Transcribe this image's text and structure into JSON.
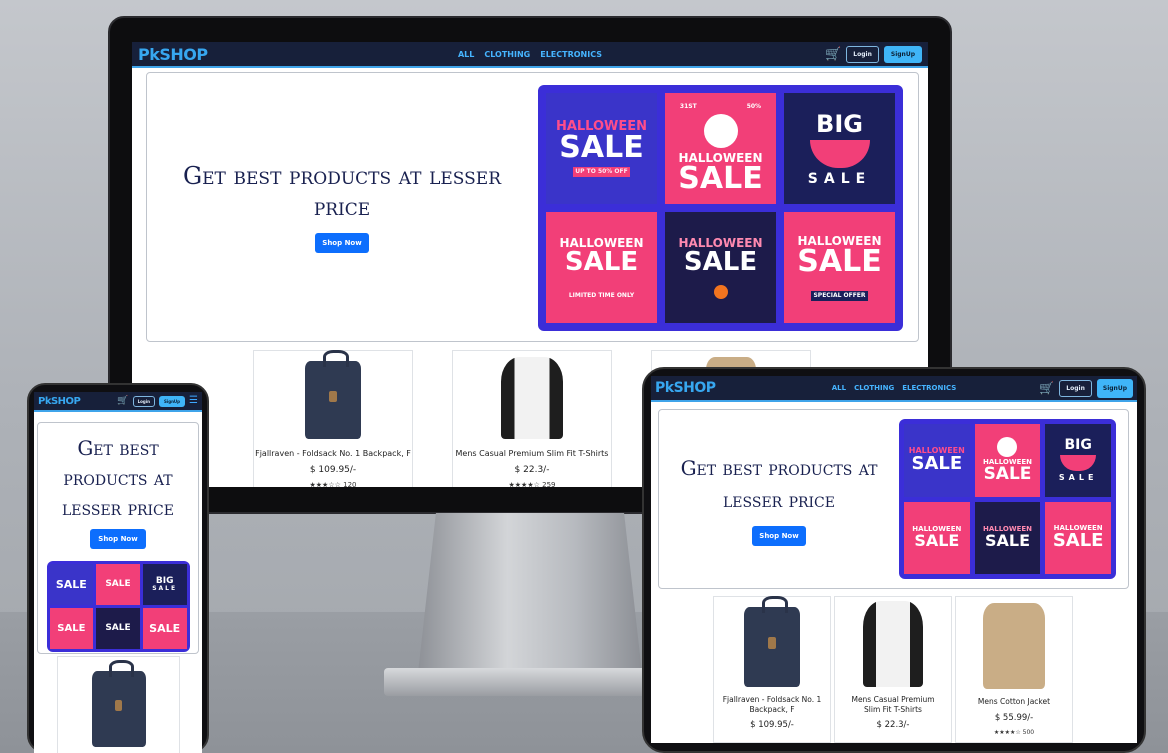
{
  "brand": "PkSHOP",
  "nav": {
    "links": [
      "ALL",
      "CLOTHING",
      "ELECTRONICS"
    ],
    "login": "Login",
    "signup": "SignUp"
  },
  "hero": {
    "tagline": "Get best products at lesser price",
    "cta": "Shop Now"
  },
  "banner": {
    "t1": {
      "l1": "HALLOWEEN",
      "l2": "SALE",
      "l3": "UP TO 50% OFF"
    },
    "t2": {
      "l0": "31ST",
      "l0b": "50%",
      "l1": "HALLOWEEN",
      "l2": "SALE"
    },
    "t3": {
      "l1": "BIG",
      "l2": "SALE"
    },
    "t4": {
      "l1": "HALLOWEEN",
      "l2": "SALE",
      "l3": "LIMITED TIME ONLY"
    },
    "t5": {
      "l1": "HALLOWEEN",
      "l2": "SALE"
    },
    "t6": {
      "l1": "HALLOWEEN",
      "l2": "SALE",
      "l3": "SPECIAL OFFER"
    }
  },
  "products": [
    {
      "title": "Fjallraven - Foldsack No. 1 Backpack, F",
      "title_tablet": "Fjallraven - Foldsack No. 1 Backpack, F",
      "price": "$ 109.95/-",
      "rating_count": "120"
    },
    {
      "title": "Mens Casual Premium Slim Fit T-Shirts",
      "price": "$ 22.3/-",
      "rating_count": "259"
    },
    {
      "title": "Mens Cotton Jacket",
      "price": "$ 55.99/-",
      "rating_count": "500"
    }
  ],
  "colors": {
    "nav": "#17203a",
    "accent": "#3fa4ea",
    "cta": "#0d6efd",
    "banner": "#3b2ed8",
    "pink": "#f23f78"
  },
  "icons": [
    "cart-icon",
    "menu-icon"
  ]
}
